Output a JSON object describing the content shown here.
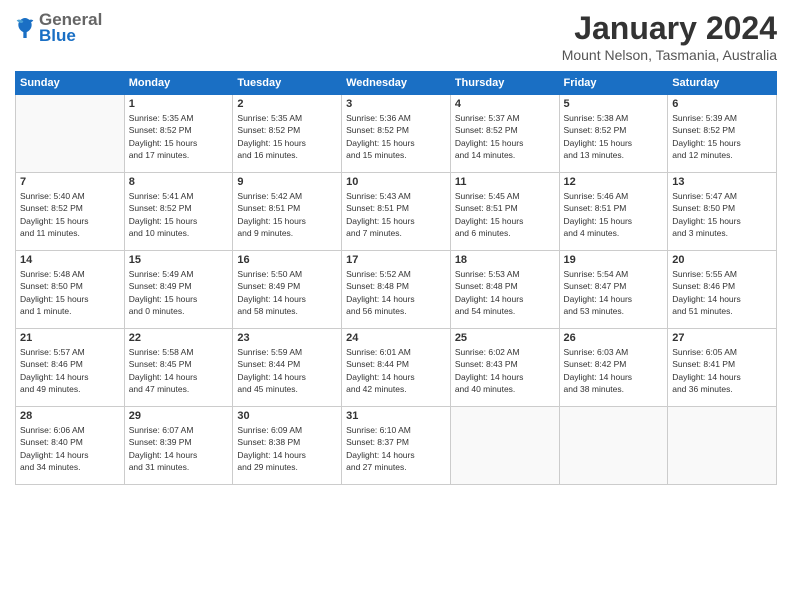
{
  "header": {
    "logo_general": "General",
    "logo_blue": "Blue",
    "title": "January 2024",
    "subtitle": "Mount Nelson, Tasmania, Australia"
  },
  "days_of_week": [
    "Sunday",
    "Monday",
    "Tuesday",
    "Wednesday",
    "Thursday",
    "Friday",
    "Saturday"
  ],
  "weeks": [
    [
      {
        "day": "",
        "info": ""
      },
      {
        "day": "1",
        "info": "Sunrise: 5:35 AM\nSunset: 8:52 PM\nDaylight: 15 hours\nand 17 minutes."
      },
      {
        "day": "2",
        "info": "Sunrise: 5:35 AM\nSunset: 8:52 PM\nDaylight: 15 hours\nand 16 minutes."
      },
      {
        "day": "3",
        "info": "Sunrise: 5:36 AM\nSunset: 8:52 PM\nDaylight: 15 hours\nand 15 minutes."
      },
      {
        "day": "4",
        "info": "Sunrise: 5:37 AM\nSunset: 8:52 PM\nDaylight: 15 hours\nand 14 minutes."
      },
      {
        "day": "5",
        "info": "Sunrise: 5:38 AM\nSunset: 8:52 PM\nDaylight: 15 hours\nand 13 minutes."
      },
      {
        "day": "6",
        "info": "Sunrise: 5:39 AM\nSunset: 8:52 PM\nDaylight: 15 hours\nand 12 minutes."
      }
    ],
    [
      {
        "day": "7",
        "info": "Sunrise: 5:40 AM\nSunset: 8:52 PM\nDaylight: 15 hours\nand 11 minutes."
      },
      {
        "day": "8",
        "info": "Sunrise: 5:41 AM\nSunset: 8:52 PM\nDaylight: 15 hours\nand 10 minutes."
      },
      {
        "day": "9",
        "info": "Sunrise: 5:42 AM\nSunset: 8:51 PM\nDaylight: 15 hours\nand 9 minutes."
      },
      {
        "day": "10",
        "info": "Sunrise: 5:43 AM\nSunset: 8:51 PM\nDaylight: 15 hours\nand 7 minutes."
      },
      {
        "day": "11",
        "info": "Sunrise: 5:45 AM\nSunset: 8:51 PM\nDaylight: 15 hours\nand 6 minutes."
      },
      {
        "day": "12",
        "info": "Sunrise: 5:46 AM\nSunset: 8:51 PM\nDaylight: 15 hours\nand 4 minutes."
      },
      {
        "day": "13",
        "info": "Sunrise: 5:47 AM\nSunset: 8:50 PM\nDaylight: 15 hours\nand 3 minutes."
      }
    ],
    [
      {
        "day": "14",
        "info": "Sunrise: 5:48 AM\nSunset: 8:50 PM\nDaylight: 15 hours\nand 1 minute."
      },
      {
        "day": "15",
        "info": "Sunrise: 5:49 AM\nSunset: 8:49 PM\nDaylight: 15 hours\nand 0 minutes."
      },
      {
        "day": "16",
        "info": "Sunrise: 5:50 AM\nSunset: 8:49 PM\nDaylight: 14 hours\nand 58 minutes."
      },
      {
        "day": "17",
        "info": "Sunrise: 5:52 AM\nSunset: 8:48 PM\nDaylight: 14 hours\nand 56 minutes."
      },
      {
        "day": "18",
        "info": "Sunrise: 5:53 AM\nSunset: 8:48 PM\nDaylight: 14 hours\nand 54 minutes."
      },
      {
        "day": "19",
        "info": "Sunrise: 5:54 AM\nSunset: 8:47 PM\nDaylight: 14 hours\nand 53 minutes."
      },
      {
        "day": "20",
        "info": "Sunrise: 5:55 AM\nSunset: 8:46 PM\nDaylight: 14 hours\nand 51 minutes."
      }
    ],
    [
      {
        "day": "21",
        "info": "Sunrise: 5:57 AM\nSunset: 8:46 PM\nDaylight: 14 hours\nand 49 minutes."
      },
      {
        "day": "22",
        "info": "Sunrise: 5:58 AM\nSunset: 8:45 PM\nDaylight: 14 hours\nand 47 minutes."
      },
      {
        "day": "23",
        "info": "Sunrise: 5:59 AM\nSunset: 8:44 PM\nDaylight: 14 hours\nand 45 minutes."
      },
      {
        "day": "24",
        "info": "Sunrise: 6:01 AM\nSunset: 8:44 PM\nDaylight: 14 hours\nand 42 minutes."
      },
      {
        "day": "25",
        "info": "Sunrise: 6:02 AM\nSunset: 8:43 PM\nDaylight: 14 hours\nand 40 minutes."
      },
      {
        "day": "26",
        "info": "Sunrise: 6:03 AM\nSunset: 8:42 PM\nDaylight: 14 hours\nand 38 minutes."
      },
      {
        "day": "27",
        "info": "Sunrise: 6:05 AM\nSunset: 8:41 PM\nDaylight: 14 hours\nand 36 minutes."
      }
    ],
    [
      {
        "day": "28",
        "info": "Sunrise: 6:06 AM\nSunset: 8:40 PM\nDaylight: 14 hours\nand 34 minutes."
      },
      {
        "day": "29",
        "info": "Sunrise: 6:07 AM\nSunset: 8:39 PM\nDaylight: 14 hours\nand 31 minutes."
      },
      {
        "day": "30",
        "info": "Sunrise: 6:09 AM\nSunset: 8:38 PM\nDaylight: 14 hours\nand 29 minutes."
      },
      {
        "day": "31",
        "info": "Sunrise: 6:10 AM\nSunset: 8:37 PM\nDaylight: 14 hours\nand 27 minutes."
      },
      {
        "day": "",
        "info": ""
      },
      {
        "day": "",
        "info": ""
      },
      {
        "day": "",
        "info": ""
      }
    ]
  ]
}
